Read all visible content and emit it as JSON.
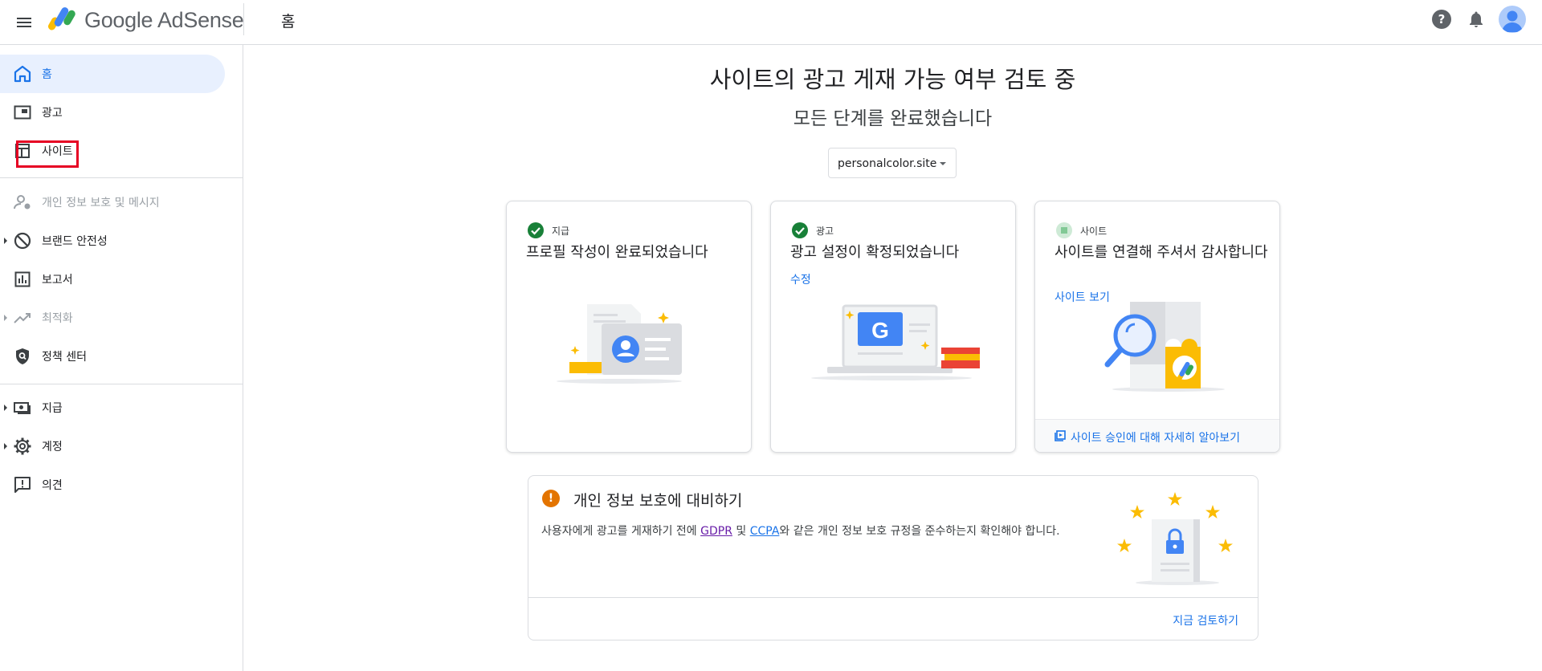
{
  "header": {
    "brand": "Google AdSense",
    "page_title": "홈",
    "help_symbol": "?"
  },
  "sidebar": {
    "items": [
      {
        "label": "홈",
        "icon": "home-icon",
        "state": "active"
      },
      {
        "label": "광고",
        "icon": "ads-icon",
        "state": "normal"
      },
      {
        "label": "사이트",
        "icon": "sites-icon",
        "state": "normal"
      },
      {
        "label": "개인 정보 보호 및 메시지",
        "icon": "privacy-messaging-icon",
        "state": "disabled"
      },
      {
        "label": "브랜드 안전성",
        "icon": "block-icon",
        "state": "normal"
      },
      {
        "label": "보고서",
        "icon": "reports-icon",
        "state": "normal"
      },
      {
        "label": "최적화",
        "icon": "trending-up-icon",
        "state": "disabled"
      },
      {
        "label": "정책 센터",
        "icon": "policy-shield-icon",
        "state": "normal"
      },
      {
        "label": "지급",
        "icon": "payments-icon",
        "state": "normal"
      },
      {
        "label": "계정",
        "icon": "gear-icon",
        "state": "normal"
      },
      {
        "label": "의견",
        "icon": "feedback-icon",
        "state": "normal"
      }
    ]
  },
  "main": {
    "title": "사이트의 광고 게재 가능 여부 검토 중",
    "subtitle": "모든 단계를 완료했습니다",
    "site_select": {
      "value": "personalcolor.site"
    },
    "cards": [
      {
        "step": "지급",
        "heading": "프로필 작성이 완료되었습니다",
        "status": "done"
      },
      {
        "step": "광고",
        "heading": "광고 설정이 확정되었습니다",
        "link": "수정",
        "status": "done"
      },
      {
        "step": "사이트",
        "heading": "사이트를 연결해 주셔서 감사합니다",
        "link": "사이트 보기",
        "footer_link": "사이트 승인에 대해 자세히 알아보기",
        "status": "pending"
      }
    ],
    "privacy": {
      "warn_symbol": "!",
      "title": "개인 정보 보호에 대비하기",
      "text_before": "사용자에게 광고를 게재하기 전에 ",
      "gdpr": "GDPR",
      "text_mid": " 및 ",
      "ccpa": "CCPA",
      "text_after": "와 같은 개인 정보 보호 규정을 준수하는지 확인해야 합니다.",
      "action": "지금 검토하기"
    }
  },
  "colors": {
    "accent": "#1a73e8",
    "active_nav_bg": "#e8f0fe",
    "success": "#188038",
    "warning": "#e37400",
    "highlight_box": "#e60023"
  }
}
